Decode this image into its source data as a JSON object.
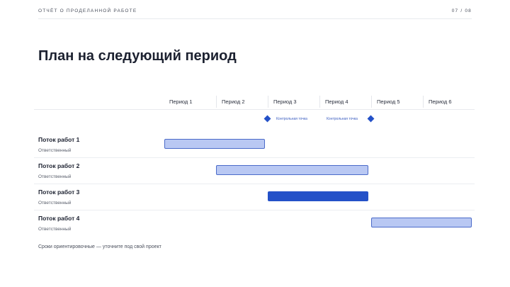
{
  "header": {
    "label": "ОТЧЁТ О ПРОДЕЛАННОЙ РАБОТЕ",
    "page_counter": "07 / 08"
  },
  "title": "План на следующий период",
  "periods": [
    "Период 1",
    "Период 2",
    "Период 3",
    "Период 4",
    "Период 5",
    "Период 6"
  ],
  "milestones": [
    {
      "label": "Контрольная точка",
      "at_period": 3.0
    },
    {
      "label": "Контрольная точка",
      "at_period": 5.0
    }
  ],
  "workstreams": [
    {
      "title": "Поток работ 1",
      "owner": "Ответственный",
      "start": 1.0,
      "end": 2.95,
      "active": false
    },
    {
      "title": "Поток работ 2",
      "owner": "Ответственный",
      "start": 2.0,
      "end": 4.95,
      "active": false
    },
    {
      "title": "Поток работ 3",
      "owner": "Ответственный",
      "start": 3.0,
      "end": 4.95,
      "active": true
    },
    {
      "title": "Поток работ 4",
      "owner": "Ответственный",
      "start": 5.0,
      "end": 6.95,
      "active": false
    }
  ],
  "footnote": "Сроки ориентировочные — уточните под свой проект",
  "colors": {
    "accent": "#2451c8",
    "bar_fill": "#b9c8f3",
    "bar_border": "#4b6bc9"
  }
}
